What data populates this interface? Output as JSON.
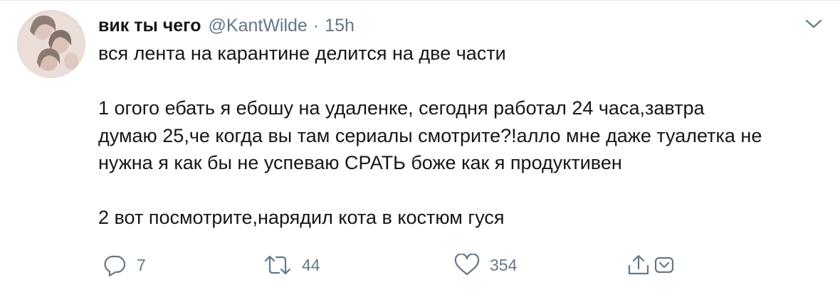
{
  "tweet": {
    "display_name": "вик ты чего",
    "handle": "@KantWilde",
    "separator": "·",
    "time": "15h",
    "lines": [
      "вся лента на карантине делится на две части",
      "",
      "1 огого ебать я ебошу на удаленке, сегодня работал 24 часа,завтра",
      "думаю 25,че когда вы там сериалы смотрите?!алло мне даже туалетка не",
      "нужна я как бы не успеваю СРАТЬ боже как я продуктивен",
      "",
      "2 вот посмотрите,нарядил кота в костюм гуся"
    ]
  },
  "actions": {
    "reply_count": "7",
    "retweet_count": "44",
    "like_count": "354"
  },
  "icons": {
    "reply": "reply-icon",
    "retweet": "retweet-icon",
    "like": "heart-icon",
    "share": "share-icon",
    "dm": "dm-icon",
    "menu": "chevron-down-icon"
  },
  "colors": {
    "text": "#14171a",
    "secondary": "#657786",
    "divider": "#e6ecf0"
  }
}
